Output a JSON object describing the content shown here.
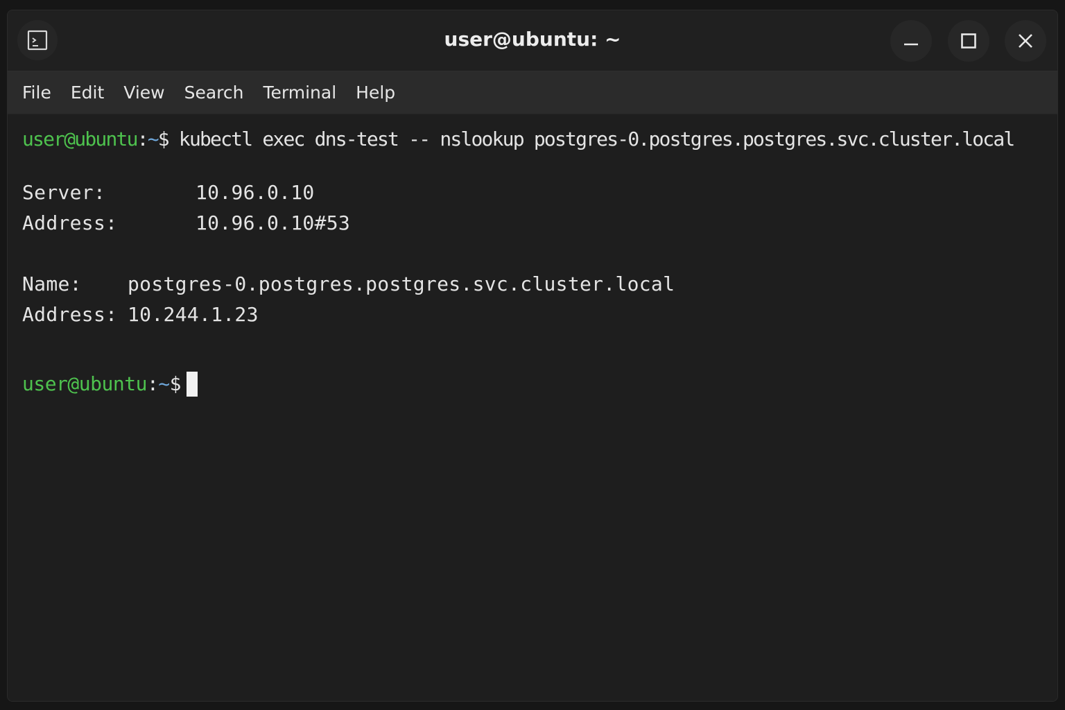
{
  "window": {
    "title": "user@ubuntu: ~",
    "icons": {
      "app": "terminal-icon",
      "minimize": "minimize-icon",
      "maximize": "maximize-icon",
      "close": "close-icon"
    }
  },
  "menu": {
    "items": [
      "File",
      "Edit",
      "View",
      "Search",
      "Terminal",
      "Help"
    ]
  },
  "terminal": {
    "prompt": {
      "user_host": "user@ubuntu",
      "colon": ":",
      "path": "~",
      "dollar": "$"
    },
    "command": " kubectl exec dns-test -- nslookup postgres-0.postgres.postgres.svc.cluster.local",
    "output": {
      "server_label": "Server:",
      "server_value": "10.96.0.10",
      "address_label": "Address:",
      "address_value": "10.96.0.10#53",
      "name_label": "Name:",
      "name_value": "postgres-0.postgres.postgres.svc.cluster.local",
      "result_address_label": "Address:",
      "result_address_value": "10.244.1.23"
    }
  },
  "colors": {
    "background": "#1e1e1e",
    "prompt_user": "#4ec24e",
    "prompt_path": "#6fa8dc",
    "text": "#e4e4e4"
  }
}
